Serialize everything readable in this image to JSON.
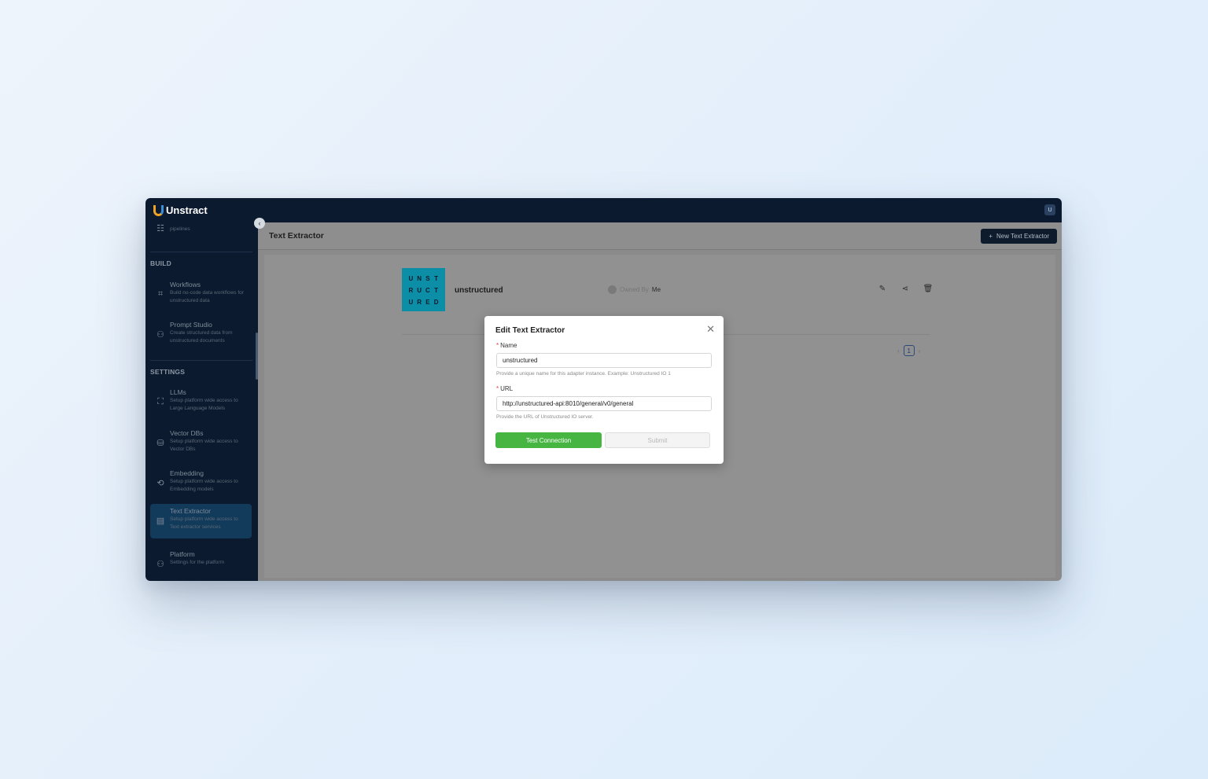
{
  "app": {
    "brand": "Unstract",
    "user_initial": "U"
  },
  "sidebar": {
    "partial_item_desc": "Ad-hoc unstructured data task pipelines",
    "sections": {
      "build": "BUILD",
      "settings": "SETTINGS"
    },
    "items": [
      {
        "key": "workflows",
        "title": "Workflows",
        "desc": "Build no-code data workflows for unstructured data",
        "icon": "workflow-icon"
      },
      {
        "key": "prompt-studio",
        "title": "Prompt Studio",
        "desc": "Create structured data from unstructured documents",
        "icon": "prompt-studio-icon"
      },
      {
        "key": "llms",
        "title": "LLMs",
        "desc": "Setup platform wide access to Large Language Models",
        "icon": "llm-icon"
      },
      {
        "key": "vector-dbs",
        "title": "Vector DBs",
        "desc": "Setup platform wide access to Vector DBs",
        "icon": "database-icon"
      },
      {
        "key": "embedding",
        "title": "Embedding",
        "desc": "Setup platform wide access to Embedding models",
        "icon": "embedding-icon"
      },
      {
        "key": "text-extractor",
        "title": "Text Extractor",
        "desc": "Setup platform wide access to Text extractor services",
        "icon": "text-extractor-icon",
        "active": true
      },
      {
        "key": "platform",
        "title": "Platform",
        "desc": "Settings for the platform",
        "icon": "platform-icon"
      }
    ]
  },
  "header": {
    "title": "Text Extractor",
    "new_button": "New Text Extractor"
  },
  "card": {
    "logo_letters": [
      "U",
      "N",
      "S",
      "T",
      "R",
      "U",
      "C",
      "T",
      "U",
      "R",
      "E",
      "D"
    ],
    "name": "unstructured",
    "owned_by_label": "Owned By",
    "owned_by_value": "Me"
  },
  "pagination": {
    "current": "1"
  },
  "modal": {
    "title": "Edit Text Extractor",
    "name_label": "Name",
    "name_value": "unstructured",
    "name_help": "Provide a unique name for this adapter instance. Example: Unstructured IO 1",
    "url_label": "URL",
    "url_value": "http://unstructured-api:8010/general/v0/general",
    "url_help": "Provide the URL of Unstructured IO server.",
    "test_button": "Test Connection",
    "submit_button": "Submit"
  },
  "colors": {
    "sidebar_bg": "#0b1a2e",
    "accent_green": "#46b542",
    "logo_teal": "#0b8ea6"
  }
}
